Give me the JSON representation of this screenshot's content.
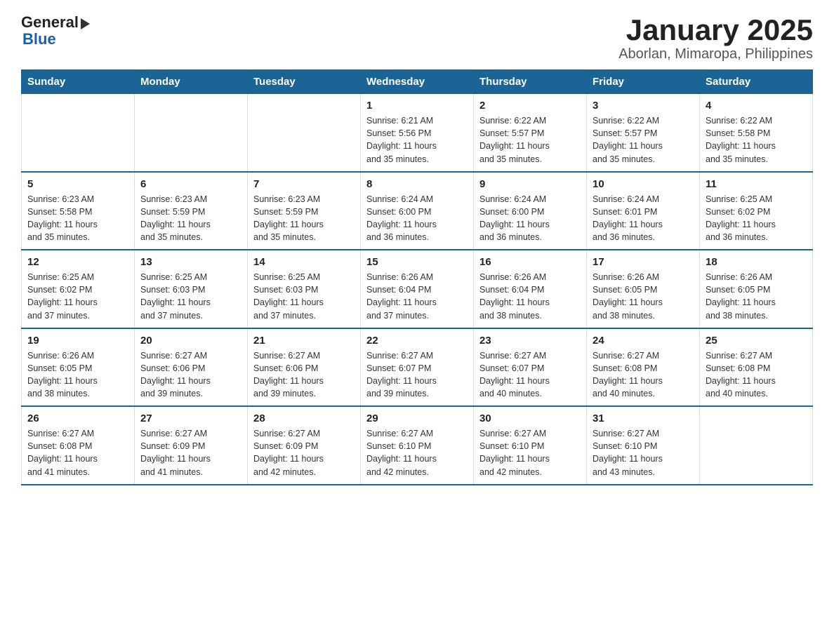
{
  "logo": {
    "general": "General",
    "blue": "Blue"
  },
  "header": {
    "title": "January 2025",
    "subtitle": "Aborlan, Mimaropa, Philippines"
  },
  "days_of_week": [
    "Sunday",
    "Monday",
    "Tuesday",
    "Wednesday",
    "Thursday",
    "Friday",
    "Saturday"
  ],
  "weeks": [
    [
      {
        "day": "",
        "info": ""
      },
      {
        "day": "",
        "info": ""
      },
      {
        "day": "",
        "info": ""
      },
      {
        "day": "1",
        "info": "Sunrise: 6:21 AM\nSunset: 5:56 PM\nDaylight: 11 hours\nand 35 minutes."
      },
      {
        "day": "2",
        "info": "Sunrise: 6:22 AM\nSunset: 5:57 PM\nDaylight: 11 hours\nand 35 minutes."
      },
      {
        "day": "3",
        "info": "Sunrise: 6:22 AM\nSunset: 5:57 PM\nDaylight: 11 hours\nand 35 minutes."
      },
      {
        "day": "4",
        "info": "Sunrise: 6:22 AM\nSunset: 5:58 PM\nDaylight: 11 hours\nand 35 minutes."
      }
    ],
    [
      {
        "day": "5",
        "info": "Sunrise: 6:23 AM\nSunset: 5:58 PM\nDaylight: 11 hours\nand 35 minutes."
      },
      {
        "day": "6",
        "info": "Sunrise: 6:23 AM\nSunset: 5:59 PM\nDaylight: 11 hours\nand 35 minutes."
      },
      {
        "day": "7",
        "info": "Sunrise: 6:23 AM\nSunset: 5:59 PM\nDaylight: 11 hours\nand 35 minutes."
      },
      {
        "day": "8",
        "info": "Sunrise: 6:24 AM\nSunset: 6:00 PM\nDaylight: 11 hours\nand 36 minutes."
      },
      {
        "day": "9",
        "info": "Sunrise: 6:24 AM\nSunset: 6:00 PM\nDaylight: 11 hours\nand 36 minutes."
      },
      {
        "day": "10",
        "info": "Sunrise: 6:24 AM\nSunset: 6:01 PM\nDaylight: 11 hours\nand 36 minutes."
      },
      {
        "day": "11",
        "info": "Sunrise: 6:25 AM\nSunset: 6:02 PM\nDaylight: 11 hours\nand 36 minutes."
      }
    ],
    [
      {
        "day": "12",
        "info": "Sunrise: 6:25 AM\nSunset: 6:02 PM\nDaylight: 11 hours\nand 37 minutes."
      },
      {
        "day": "13",
        "info": "Sunrise: 6:25 AM\nSunset: 6:03 PM\nDaylight: 11 hours\nand 37 minutes."
      },
      {
        "day": "14",
        "info": "Sunrise: 6:25 AM\nSunset: 6:03 PM\nDaylight: 11 hours\nand 37 minutes."
      },
      {
        "day": "15",
        "info": "Sunrise: 6:26 AM\nSunset: 6:04 PM\nDaylight: 11 hours\nand 37 minutes."
      },
      {
        "day": "16",
        "info": "Sunrise: 6:26 AM\nSunset: 6:04 PM\nDaylight: 11 hours\nand 38 minutes."
      },
      {
        "day": "17",
        "info": "Sunrise: 6:26 AM\nSunset: 6:05 PM\nDaylight: 11 hours\nand 38 minutes."
      },
      {
        "day": "18",
        "info": "Sunrise: 6:26 AM\nSunset: 6:05 PM\nDaylight: 11 hours\nand 38 minutes."
      }
    ],
    [
      {
        "day": "19",
        "info": "Sunrise: 6:26 AM\nSunset: 6:05 PM\nDaylight: 11 hours\nand 38 minutes."
      },
      {
        "day": "20",
        "info": "Sunrise: 6:27 AM\nSunset: 6:06 PM\nDaylight: 11 hours\nand 39 minutes."
      },
      {
        "day": "21",
        "info": "Sunrise: 6:27 AM\nSunset: 6:06 PM\nDaylight: 11 hours\nand 39 minutes."
      },
      {
        "day": "22",
        "info": "Sunrise: 6:27 AM\nSunset: 6:07 PM\nDaylight: 11 hours\nand 39 minutes."
      },
      {
        "day": "23",
        "info": "Sunrise: 6:27 AM\nSunset: 6:07 PM\nDaylight: 11 hours\nand 40 minutes."
      },
      {
        "day": "24",
        "info": "Sunrise: 6:27 AM\nSunset: 6:08 PM\nDaylight: 11 hours\nand 40 minutes."
      },
      {
        "day": "25",
        "info": "Sunrise: 6:27 AM\nSunset: 6:08 PM\nDaylight: 11 hours\nand 40 minutes."
      }
    ],
    [
      {
        "day": "26",
        "info": "Sunrise: 6:27 AM\nSunset: 6:08 PM\nDaylight: 11 hours\nand 41 minutes."
      },
      {
        "day": "27",
        "info": "Sunrise: 6:27 AM\nSunset: 6:09 PM\nDaylight: 11 hours\nand 41 minutes."
      },
      {
        "day": "28",
        "info": "Sunrise: 6:27 AM\nSunset: 6:09 PM\nDaylight: 11 hours\nand 42 minutes."
      },
      {
        "day": "29",
        "info": "Sunrise: 6:27 AM\nSunset: 6:10 PM\nDaylight: 11 hours\nand 42 minutes."
      },
      {
        "day": "30",
        "info": "Sunrise: 6:27 AM\nSunset: 6:10 PM\nDaylight: 11 hours\nand 42 minutes."
      },
      {
        "day": "31",
        "info": "Sunrise: 6:27 AM\nSunset: 6:10 PM\nDaylight: 11 hours\nand 43 minutes."
      },
      {
        "day": "",
        "info": ""
      }
    ]
  ]
}
